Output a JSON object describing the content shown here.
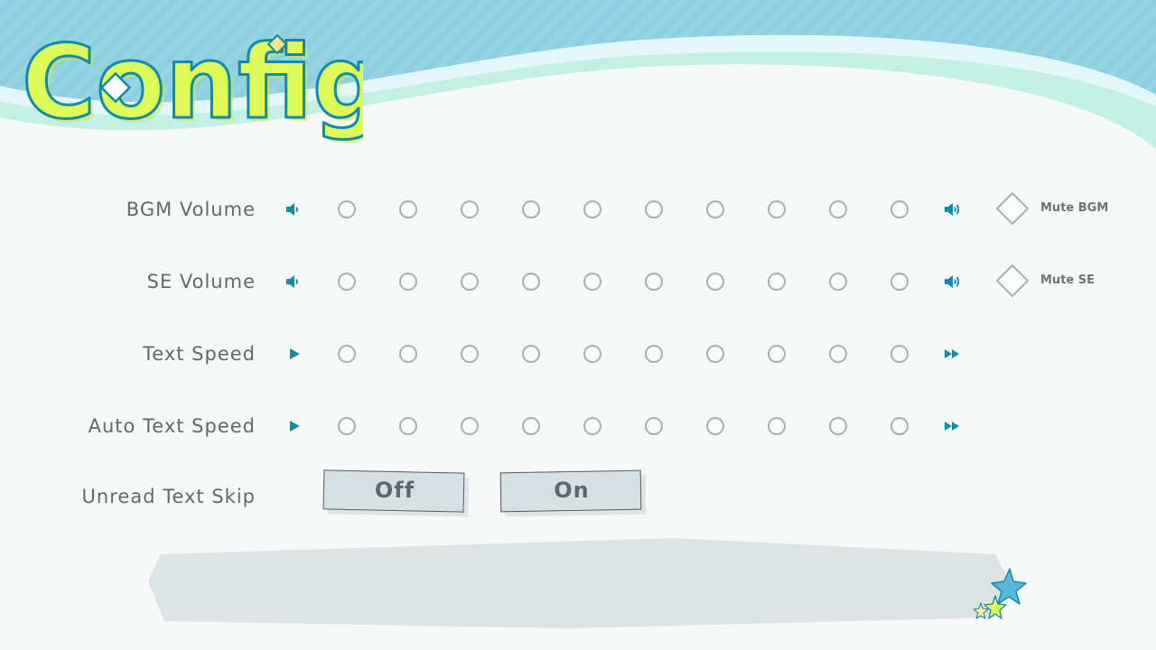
{
  "title": "Config",
  "rows": [
    {
      "label": "BGM Volume",
      "low_icon": "speaker-low-icon",
      "high_icon": "speaker-high-icon",
      "mute_label": "Mute BGM"
    },
    {
      "label": "SE Volume",
      "low_icon": "speaker-low-icon",
      "high_icon": "speaker-high-icon",
      "mute_label": "Mute SE"
    },
    {
      "label": "Text Speed",
      "low_icon": "play-icon",
      "high_icon": "fast-forward-icon"
    },
    {
      "label": "Auto Text Speed",
      "low_icon": "play-icon",
      "high_icon": "fast-forward-icon"
    }
  ],
  "slider_steps": 10,
  "unread_skip": {
    "label": "Unread Text Skip",
    "off_label": "Off",
    "on_label": "On"
  },
  "colors": {
    "accent": "#138aa8",
    "label_text": "#5d6b6d",
    "dot_border": "#a3b1b4",
    "logo_fill": "#ddfa58",
    "banner_blue": "#8fd0e0",
    "banner_mint": "#c4efe4",
    "message_box": "#dce3e4"
  }
}
